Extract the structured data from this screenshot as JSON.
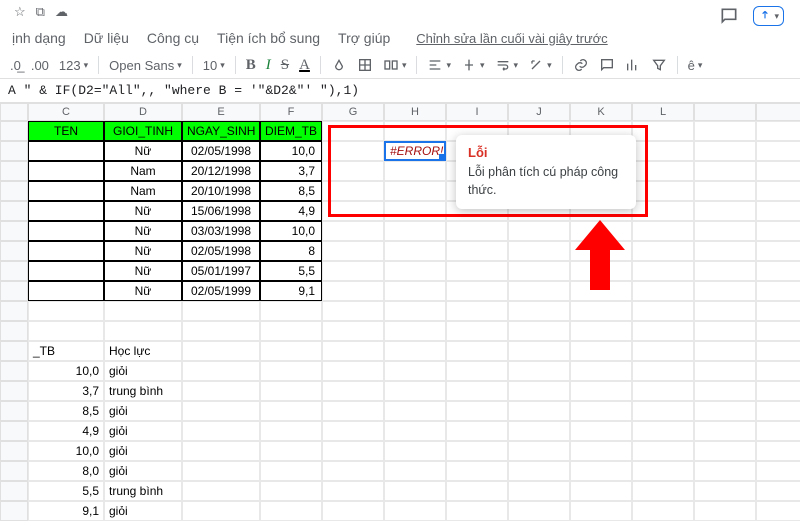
{
  "header": {
    "star": "☆",
    "move": "⧉",
    "cloud": "☁"
  },
  "menu": {
    "format": "ịnh dạng",
    "data": "Dữ liệu",
    "tools": "Công cụ",
    "addons": "Tiện ích bổ sung",
    "help": "Trợ giúp",
    "editStatus": "Chỉnh sửa lần cuối vài giây trước"
  },
  "toolbar": {
    "dec1": ".0",
    "dec2": ".00",
    "numfmt": "123",
    "font": "Open Sans",
    "size": "10",
    "bold": "B",
    "italic": "I",
    "strike": "S",
    "textcolor": "A",
    "sigma": "ê"
  },
  "formula": "A \" & IF(D2=\"All\",, \"where B = '\"&D2&\"' \"),1)",
  "cols": [
    "",
    "C",
    "D",
    "E",
    "F",
    "G",
    "H",
    "I",
    "J",
    "K",
    "L"
  ],
  "tableHeaders": {
    "c": "TEN",
    "d": "GIOI_TINH",
    "e": "NGAY_SINH",
    "f": "DIEM_TB"
  },
  "rows": [
    {
      "d": "Nữ",
      "e": "02/05/1998",
      "f": "10,0"
    },
    {
      "d": "Nam",
      "e": "20/12/1998",
      "f": "3,7"
    },
    {
      "d": "Nam",
      "e": "20/10/1998",
      "f": "8,5"
    },
    {
      "d": "Nữ",
      "e": "15/06/1998",
      "f": "4,9"
    },
    {
      "d": "Nữ",
      "e": "03/03/1998",
      "f": "10,0"
    },
    {
      "d": "Nữ",
      "e": "02/05/1998",
      "f": "8"
    },
    {
      "d": "Nữ",
      "e": "05/01/1997",
      "f": "5,5"
    },
    {
      "d": "Nữ",
      "e": "02/05/1999",
      "f": "9,1"
    }
  ],
  "lower": {
    "headerC": "_TB",
    "headerD": "Học lực",
    "rows": [
      {
        "c": "10,0",
        "d": "giỏi"
      },
      {
        "c": "3,7",
        "d": "trung bình"
      },
      {
        "c": "8,5",
        "d": "giỏi"
      },
      {
        "c": "4,9",
        "d": "giỏi"
      },
      {
        "c": "10,0",
        "d": "giỏi"
      },
      {
        "c": "8,0",
        "d": "giỏi"
      },
      {
        "c": "5,5",
        "d": "trung bình"
      },
      {
        "c": "9,1",
        "d": "giỏi"
      }
    ]
  },
  "error": {
    "cellText": "#ERROR!",
    "title": "Lỗi",
    "body": "Lỗi phân tích cú pháp công thức."
  }
}
